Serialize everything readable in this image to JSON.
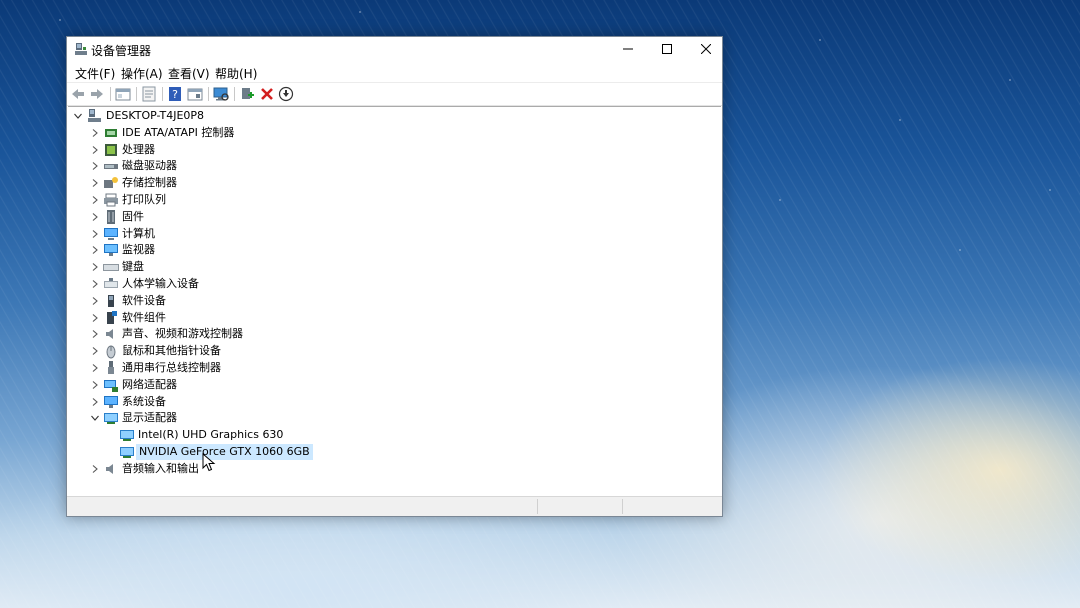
{
  "window": {
    "title": "设备管理器",
    "icon": "device-manager-icon",
    "controls": [
      "minimize",
      "maximize",
      "close"
    ]
  },
  "menubar": [
    "文件(F)",
    "操作(A)",
    "查看(V)",
    "帮助(H)"
  ],
  "toolbar": [
    "back-icon",
    "forward-icon",
    "properties-icon",
    "update-driver-icon",
    "help-icon",
    "show-hidden-icon",
    "scan-hardware-icon",
    "enable-device-icon",
    "uninstall-icon",
    "download-icon"
  ],
  "tree": {
    "root": "DESKTOP-T4JE0P8",
    "categories": [
      {
        "label": "IDE ATA/ATAPI 控制器",
        "icon": "ide-controller-icon",
        "expanded": false
      },
      {
        "label": "处理器",
        "icon": "processor-icon",
        "expanded": false
      },
      {
        "label": "磁盘驱动器",
        "icon": "disk-drive-icon",
        "expanded": false
      },
      {
        "label": "存储控制器",
        "icon": "storage-controller-icon",
        "expanded": false
      },
      {
        "label": "打印队列",
        "icon": "printer-icon",
        "expanded": false
      },
      {
        "label": "固件",
        "icon": "firmware-icon",
        "expanded": false
      },
      {
        "label": "计算机",
        "icon": "computer-icon",
        "expanded": false
      },
      {
        "label": "监视器",
        "icon": "monitor-icon",
        "expanded": false
      },
      {
        "label": "键盘",
        "icon": "keyboard-icon",
        "expanded": false
      },
      {
        "label": "人体学输入设备",
        "icon": "hid-icon",
        "expanded": false
      },
      {
        "label": "软件设备",
        "icon": "software-device-icon",
        "expanded": false
      },
      {
        "label": "软件组件",
        "icon": "software-component-icon",
        "expanded": false
      },
      {
        "label": "声音、视频和游戏控制器",
        "icon": "sound-icon",
        "expanded": false
      },
      {
        "label": "鼠标和其他指针设备",
        "icon": "mouse-icon",
        "expanded": false
      },
      {
        "label": "通用串行总线控制器",
        "icon": "usb-icon",
        "expanded": false
      },
      {
        "label": "网络适配器",
        "icon": "network-adapter-icon",
        "expanded": false
      },
      {
        "label": "系统设备",
        "icon": "system-device-icon",
        "expanded": false
      },
      {
        "label": "显示适配器",
        "icon": "display-adapter-icon",
        "expanded": true,
        "children": [
          {
            "label": "Intel(R) UHD Graphics 630",
            "icon": "display-adapter-icon",
            "selected": false
          },
          {
            "label": "NVIDIA GeForce GTX 1060 6GB",
            "icon": "display-adapter-icon",
            "selected": true
          }
        ]
      },
      {
        "label": "音频输入和输出",
        "icon": "audio-io-icon",
        "expanded": false
      }
    ]
  },
  "colors": {
    "selection": "#cce8ff",
    "accent": "#0078d7"
  }
}
